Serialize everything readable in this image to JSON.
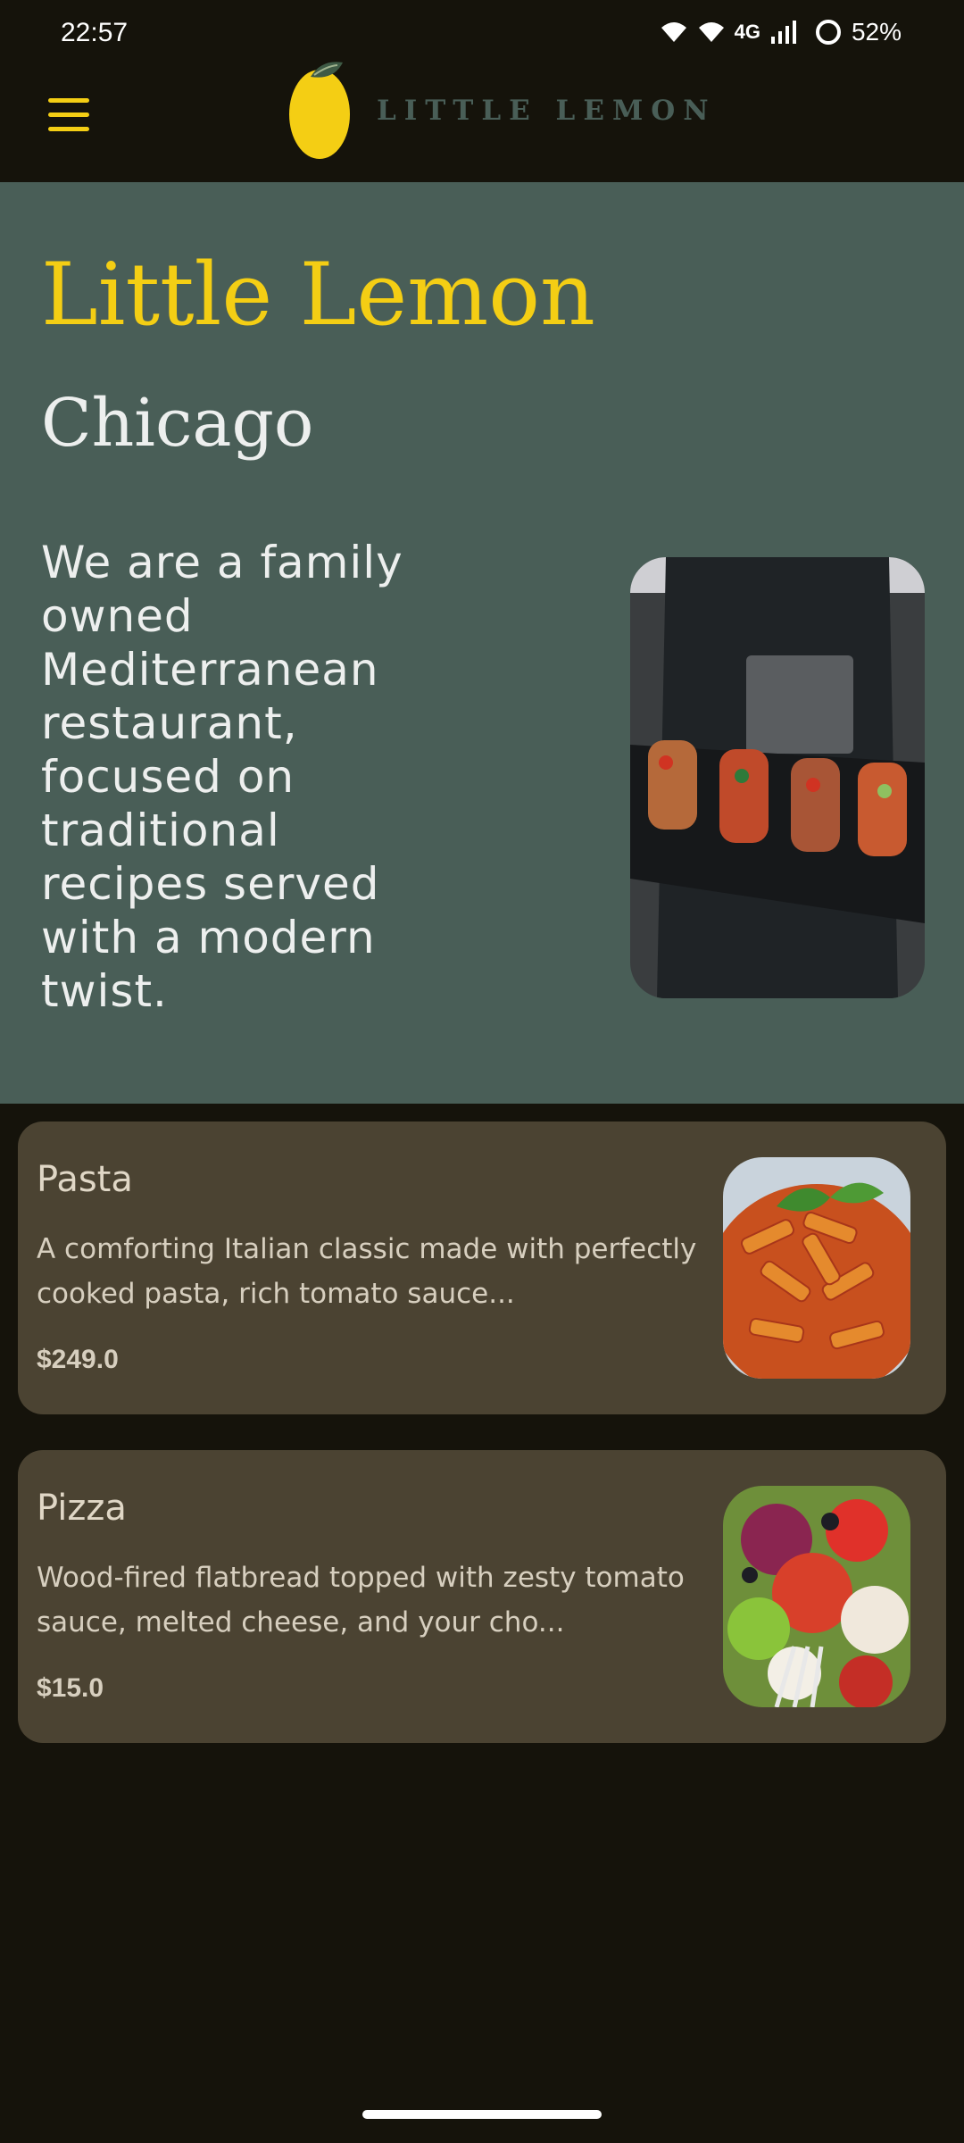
{
  "status_bar": {
    "time": "22:57",
    "network": "4G",
    "battery": "52%",
    "icons": [
      "wifi-icon",
      "wifi-icon",
      "signal-icon",
      "battery-ring-icon"
    ]
  },
  "app_bar": {
    "menu_icon": "hamburger-menu-icon",
    "brand_name": "LITTLE LEMON",
    "accent_color": "#f4ce14",
    "brand_color": "#495e57"
  },
  "hero": {
    "title": "Little Lemon",
    "subtitle": "Chicago",
    "description": "We are a family owned Mediterranean restaurant, focused on traditional recipes served with a modern twist.",
    "background_color": "#495e57"
  },
  "menu_items": [
    {
      "name": "Pasta",
      "description": "A comforting Italian classic made with perfectly cooked pasta, rich tomato sauce...",
      "price": "$249.0"
    },
    {
      "name": "Pizza",
      "description": "Wood-fired flatbread topped with zesty tomato sauce, melted cheese, and your cho...",
      "price": "$15.0"
    }
  ]
}
